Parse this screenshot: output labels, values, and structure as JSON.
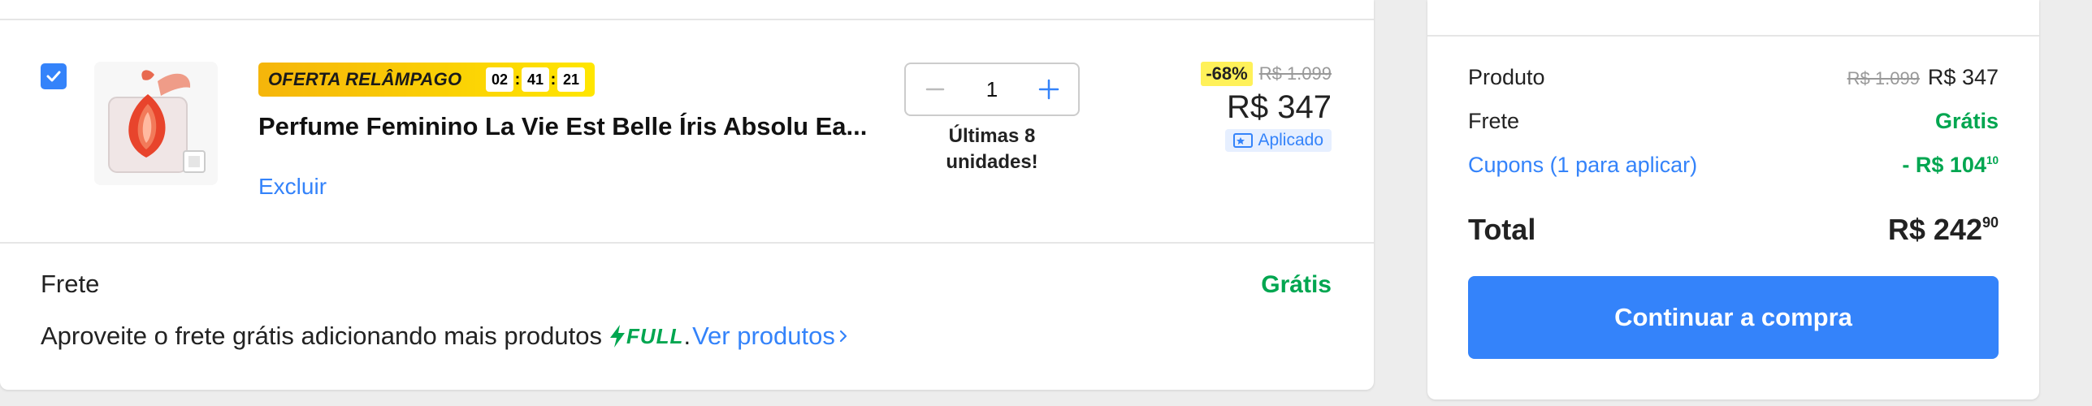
{
  "item": {
    "badge_label": "OFERTA RELÂMPAGO",
    "timer": {
      "hours": "02",
      "minutes": "41",
      "seconds": "21"
    },
    "title": "Perfume Feminino La Vie Est Belle Íris Absolu Ea...",
    "delete_label": "Excluir",
    "quantity": "1",
    "stock_note_line1": "Últimas 8",
    "stock_note_line2": "unidades!",
    "discount": "-68%",
    "old_price": "R$ 1.099",
    "price": "R$ 347",
    "applied_label": "Aplicado"
  },
  "shipping": {
    "label": "Frete",
    "value": "Grátis",
    "promo_text": "Aproveite o frete grátis adicionando mais produtos",
    "full_label": "FULL",
    "promo_link": "Ver produtos"
  },
  "summary": {
    "product_label": "Produto",
    "product_old": "R$ 1.099",
    "product_value": "R$ 347",
    "shipping_label": "Frete",
    "shipping_value": "Grátis",
    "coupons_label": "Cupons (1 para aplicar)",
    "coupons_value": "- R$ 104",
    "coupons_cents": "10",
    "total_label": "Total",
    "total_value": "R$ 242",
    "total_cents": "90",
    "cta_label": "Continuar a compra"
  },
  "colors": {
    "accent": "#3483fa",
    "success": "#00a650",
    "badge_yellow": "#ffe600"
  }
}
